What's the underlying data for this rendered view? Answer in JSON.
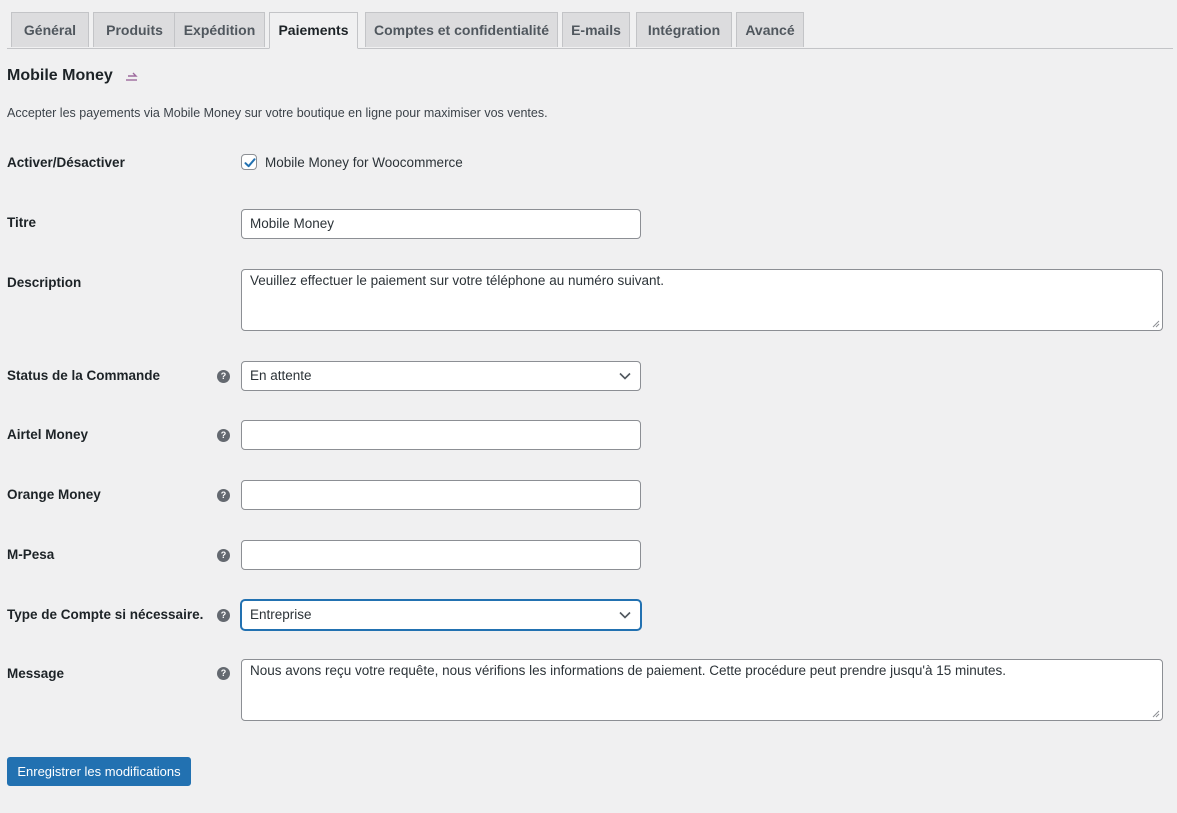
{
  "tabs": [
    {
      "label": "Général",
      "active": false
    },
    {
      "label": "Produits",
      "active": false
    },
    {
      "label": "Expédition",
      "active": false
    },
    {
      "label": "Paiements",
      "active": true
    },
    {
      "label": "Comptes et confidentialité",
      "active": false
    },
    {
      "label": "E-mails",
      "active": false
    },
    {
      "label": "Intégration",
      "active": false
    },
    {
      "label": "Avancé",
      "active": false
    }
  ],
  "section": {
    "title": "Mobile Money",
    "description": "Accepter les payements via Mobile Money sur votre boutique en ligne pour maximiser vos ventes."
  },
  "fields": {
    "enable": {
      "label": "Activer/Désactiver",
      "checkbox_label": "Mobile Money for Woocommerce",
      "checked": true
    },
    "title": {
      "label": "Titre",
      "value": "Mobile Money"
    },
    "description": {
      "label": "Description",
      "value": "Veuillez effectuer le paiement sur votre téléphone au numéro suivant."
    },
    "order_status": {
      "label": "Status de la Commande",
      "value": "En attente"
    },
    "airtel": {
      "label": "Airtel Money",
      "value": ""
    },
    "orange": {
      "label": "Orange Money",
      "value": ""
    },
    "mpesa": {
      "label": "M-Pesa",
      "value": ""
    },
    "account_type": {
      "label": "Type de Compte si nécessaire.",
      "value": "Entreprise"
    },
    "message": {
      "label": "Message",
      "value": "Nous avons reçu votre requête, nous vérifions les informations de paiement. Cette procédure peut prendre jusqu'à 15 minutes."
    }
  },
  "help_glyph": "?",
  "save_button": "Enregistrer les modifications",
  "colors": {
    "accent": "#2271b1",
    "background": "#f0f0f1",
    "tab_inactive": "#dcdcde"
  }
}
